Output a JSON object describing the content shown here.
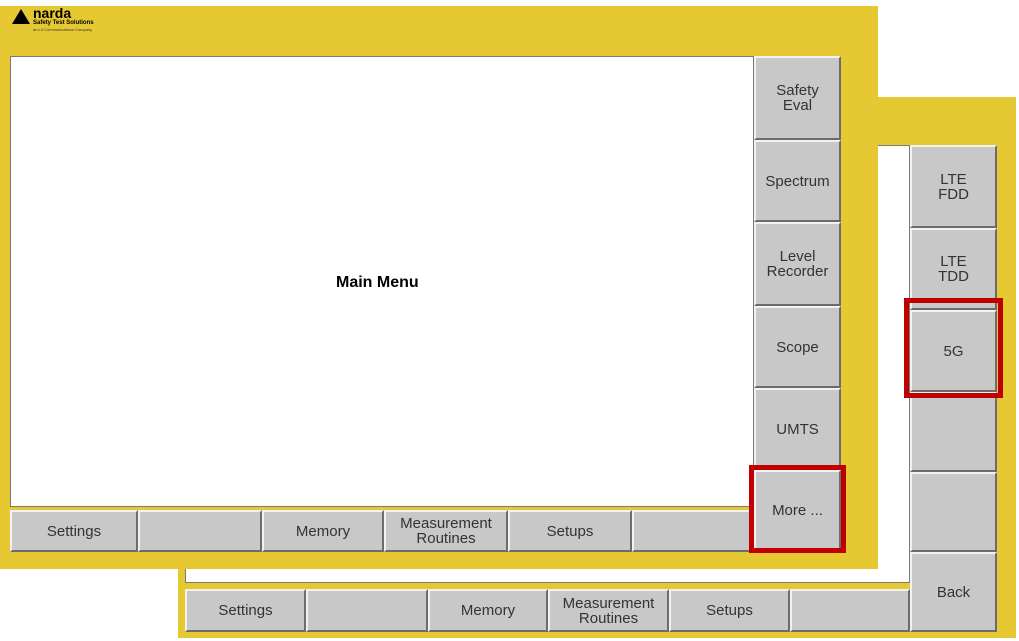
{
  "logo": {
    "name": "narda",
    "subtitle": "Safety Test Solutions",
    "tagline": "an L3 Communications Company"
  },
  "front": {
    "title": "Main Menu",
    "side_buttons": [
      "Safety\nEval",
      "Spectrum",
      "Level\nRecorder",
      "Scope",
      "UMTS",
      "More ..."
    ],
    "bottom_buttons": [
      "Settings",
      "",
      "Memory",
      "Measurement\nRoutines",
      "Setups",
      ""
    ]
  },
  "back": {
    "side_buttons": [
      "LTE\nFDD",
      "LTE\nTDD",
      "5G",
      "",
      "",
      "Back"
    ],
    "bottom_buttons": [
      "Settings",
      "",
      "Memory",
      "Measurement\nRoutines",
      "Setups",
      ""
    ]
  },
  "colors": {
    "frame": "#e6c832",
    "button": "#c8c8c8",
    "highlight": "#c00000"
  }
}
